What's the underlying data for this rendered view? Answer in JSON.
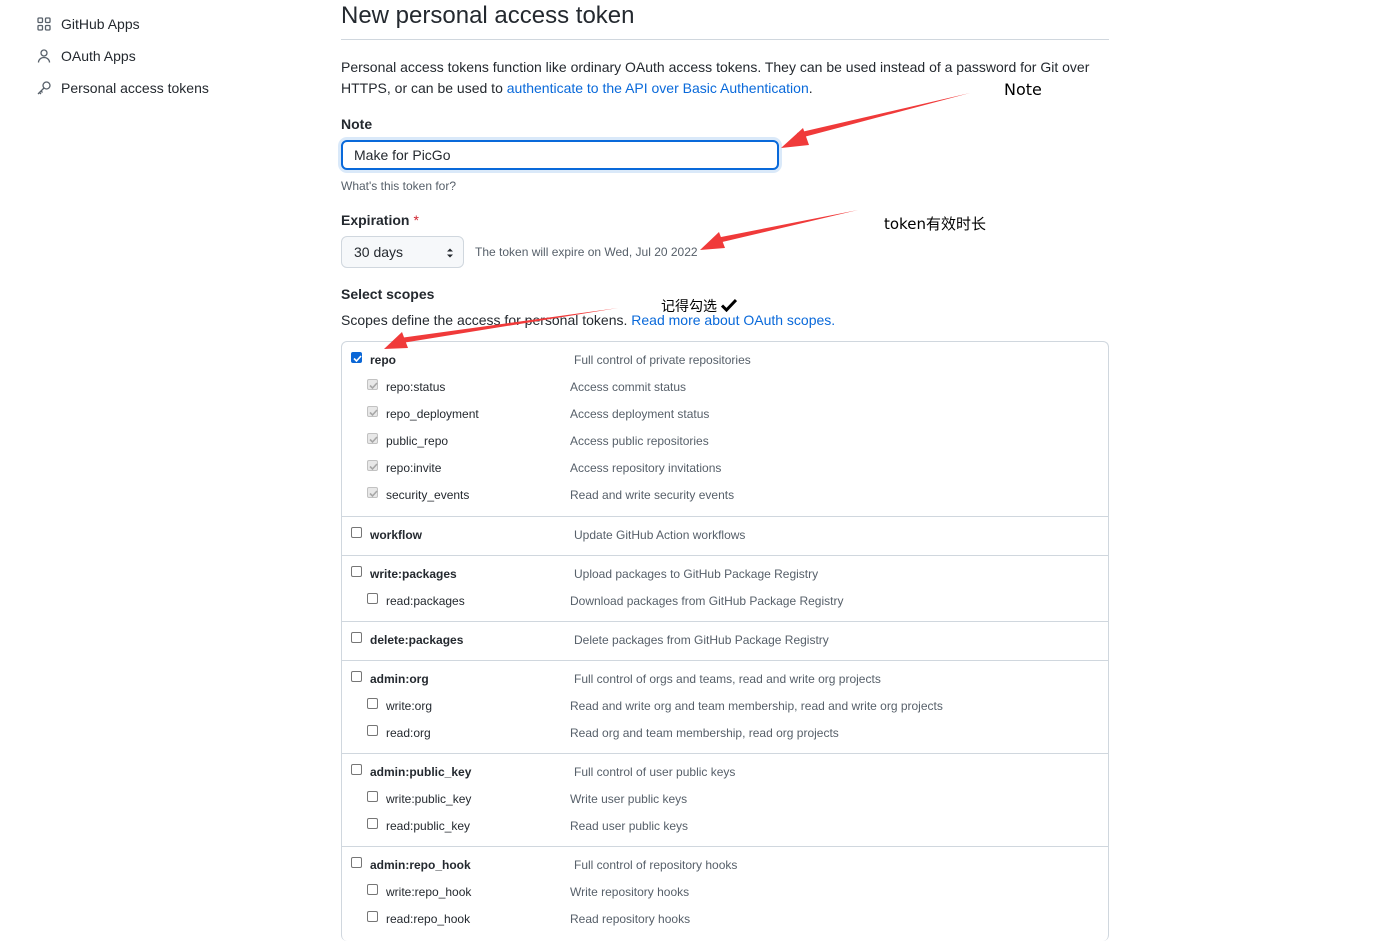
{
  "sidebar": {
    "items": [
      {
        "label": "GitHub Apps",
        "icon": "apps-grid-icon"
      },
      {
        "label": "OAuth Apps",
        "icon": "person-icon"
      },
      {
        "label": "Personal access tokens",
        "icon": "key-icon"
      }
    ]
  },
  "page": {
    "title": "New personal access token",
    "intro_text": "Personal access tokens function like ordinary OAuth access tokens. They can be used instead of a password for Git over HTTPS, or can be used to ",
    "intro_link": "authenticate to the API over Basic Authentication",
    "intro_end": "."
  },
  "note": {
    "label": "Note",
    "value": "Make for PicGo",
    "hint": "What's this token for?"
  },
  "expiration": {
    "label": "Expiration",
    "required_mark": "*",
    "selected": "30 days",
    "expire_text": "The token will expire on Wed, Jul 20 2022"
  },
  "scopes": {
    "label": "Select scopes",
    "desc": "Scopes define the access for personal tokens. ",
    "desc_link": "Read more about OAuth scopes.",
    "groups": [
      {
        "name": "repo",
        "desc": "Full control of private repositories",
        "checked": true,
        "children": [
          {
            "name": "repo:status",
            "desc": "Access commit status"
          },
          {
            "name": "repo_deployment",
            "desc": "Access deployment status"
          },
          {
            "name": "public_repo",
            "desc": "Access public repositories"
          },
          {
            "name": "repo:invite",
            "desc": "Access repository invitations"
          },
          {
            "name": "security_events",
            "desc": "Read and write security events"
          }
        ]
      },
      {
        "name": "workflow",
        "desc": "Update GitHub Action workflows",
        "checked": false,
        "children": []
      },
      {
        "name": "write:packages",
        "desc": "Upload packages to GitHub Package Registry",
        "checked": false,
        "children": [
          {
            "name": "read:packages",
            "desc": "Download packages from GitHub Package Registry"
          }
        ]
      },
      {
        "name": "delete:packages",
        "desc": "Delete packages from GitHub Package Registry",
        "checked": false,
        "children": []
      },
      {
        "name": "admin:org",
        "desc": "Full control of orgs and teams, read and write org projects",
        "checked": false,
        "children": [
          {
            "name": "write:org",
            "desc": "Read and write org and team membership, read and write org projects"
          },
          {
            "name": "read:org",
            "desc": "Read org and team membership, read org projects"
          }
        ]
      },
      {
        "name": "admin:public_key",
        "desc": "Full control of user public keys",
        "checked": false,
        "children": [
          {
            "name": "write:public_key",
            "desc": "Write user public keys"
          },
          {
            "name": "read:public_key",
            "desc": "Read user public keys"
          }
        ]
      },
      {
        "name": "admin:repo_hook",
        "desc": "Full control of repository hooks",
        "checked": false,
        "children": [
          {
            "name": "write:repo_hook",
            "desc": "Write repository hooks"
          },
          {
            "name": "read:repo_hook",
            "desc": "Read repository hooks"
          }
        ]
      }
    ]
  },
  "annotations": {
    "note": "Note",
    "expiry": "token有效时长",
    "check": "记得勾选",
    "arrow_color": "#f03a3a"
  }
}
